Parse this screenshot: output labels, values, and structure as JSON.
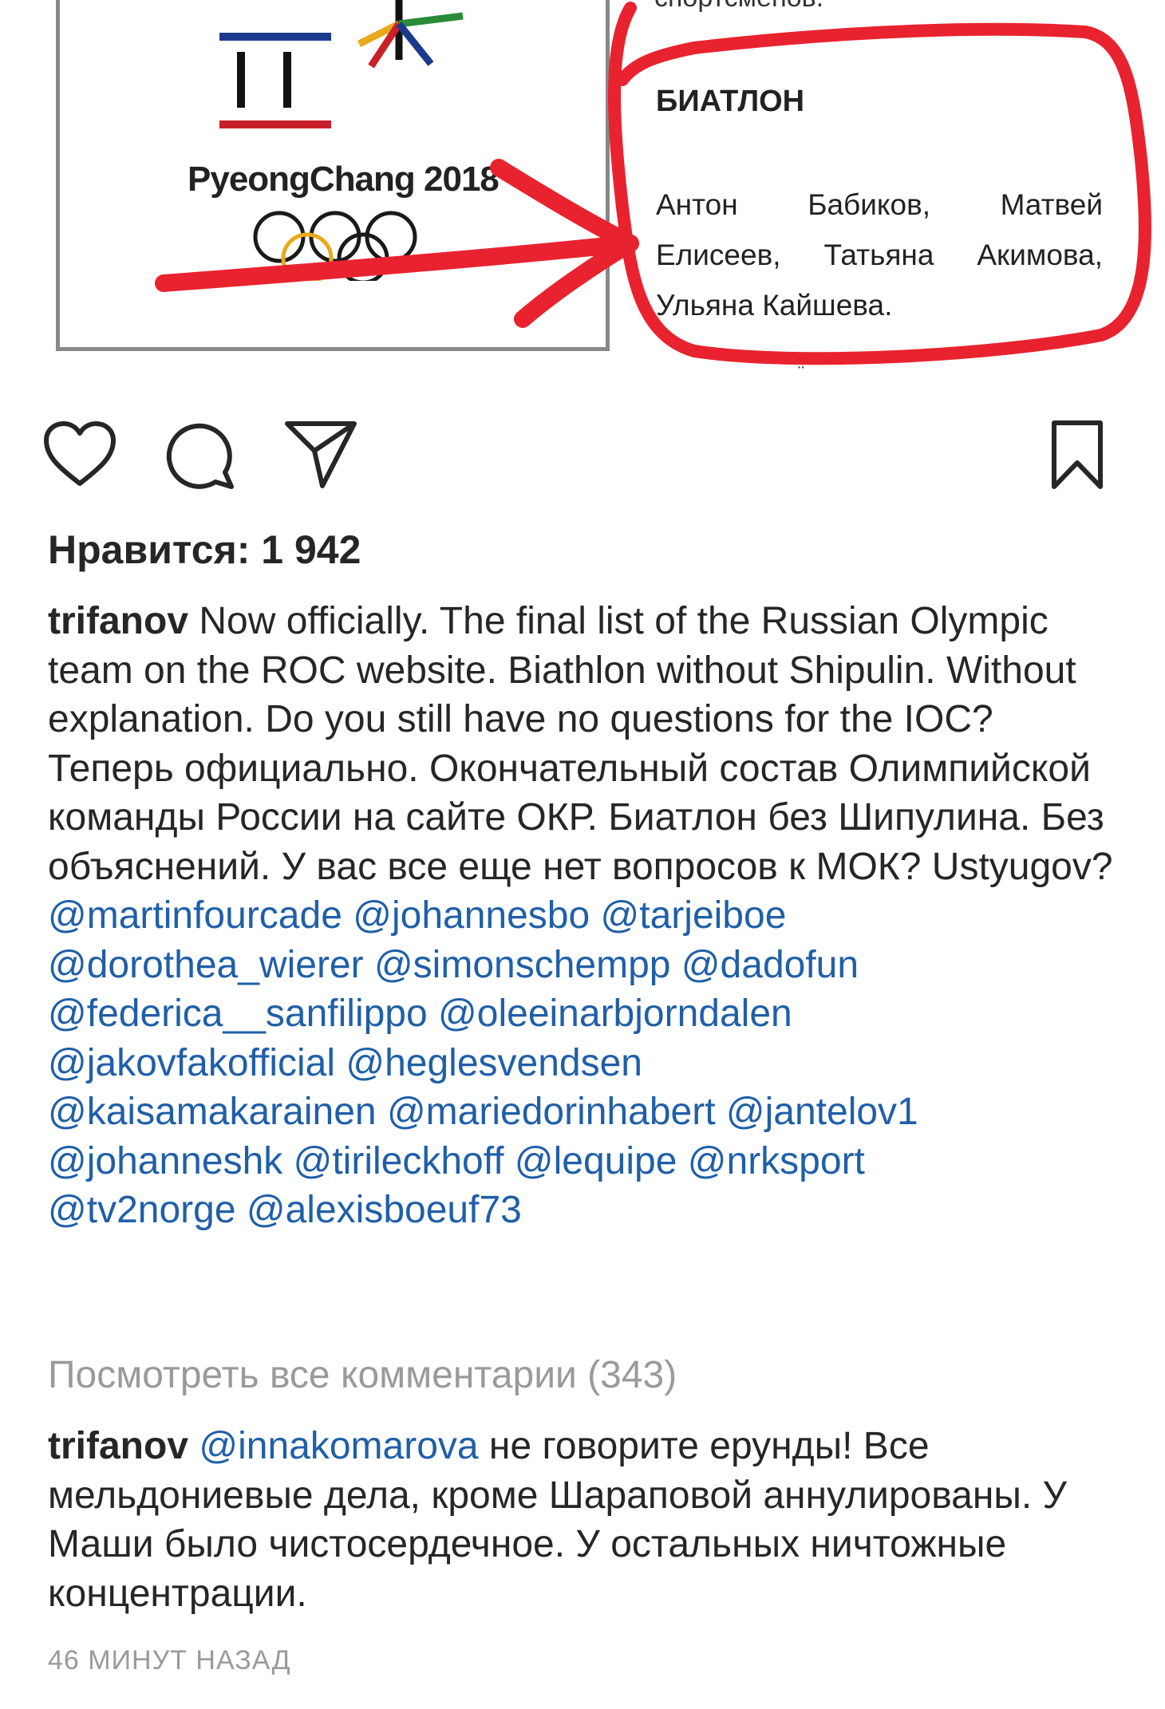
{
  "post_image": {
    "doc_top_text": "спортсменов.",
    "sport_heading": "БИАТЛОН",
    "athletes_lines": [
      "Антон Бабиков, Матвей",
      "Елисеев, Татьяна Акимова,",
      "Ульяна Кайшева."
    ],
    "logo_text": "PyeongChang 2018",
    "annotation_color": "#e8232f"
  },
  "actions": {
    "like": "heart-icon",
    "comment": "comment-icon",
    "share": "paper-plane-icon",
    "save": "bookmark-icon"
  },
  "likes_text": "Нравится: 1 942",
  "caption": {
    "username": "trifanov",
    "text_en": " Now officially. The final list of the Russian Olympic team on the ROC website. Biathlon without Shipulin. Without explanation. Do you still have no questions for the IOC?",
    "text_ru": "Теперь официально. Окончательный состав Олимпийской команды России на сайте ОКР. Биатлон без Шипулина. Без объяснений. У вас все еще нет вопросов к МОК?  Ustyugov?",
    "mentions": [
      "@martinfourcade",
      "@johannesbo",
      "@tarjeiboe",
      "@dorothea_wierer",
      "@simonschempp",
      "@dadofun",
      "@federica__sanfilippo",
      "@oleeinarbjorndalen",
      "@jakovfakofficial",
      "@heglesvendsen",
      "@kaisamakarainen",
      "@mariedorinhabert",
      "@jantelov1",
      "@johanneshk",
      "@tirileckhoff",
      "@lequipe",
      "@nrksport",
      "@tv2norge",
      "@alexisboeuf73"
    ]
  },
  "view_all_comments": "Посмотреть все комментарии (343)",
  "comment": {
    "username": "trifanov",
    "mention": "@innakomarova",
    "text": " не говорите ерунды! Все мельдониевые дела, кроме Шараповой аннулированы. У Маши было чистосердечное. У остальных ничтожные концентрации."
  },
  "timestamp": "46 МИНУТ НАЗАД",
  "colors": {
    "mention": "#1f5fa8",
    "muted": "#9a9a9a",
    "text": "#262626"
  }
}
